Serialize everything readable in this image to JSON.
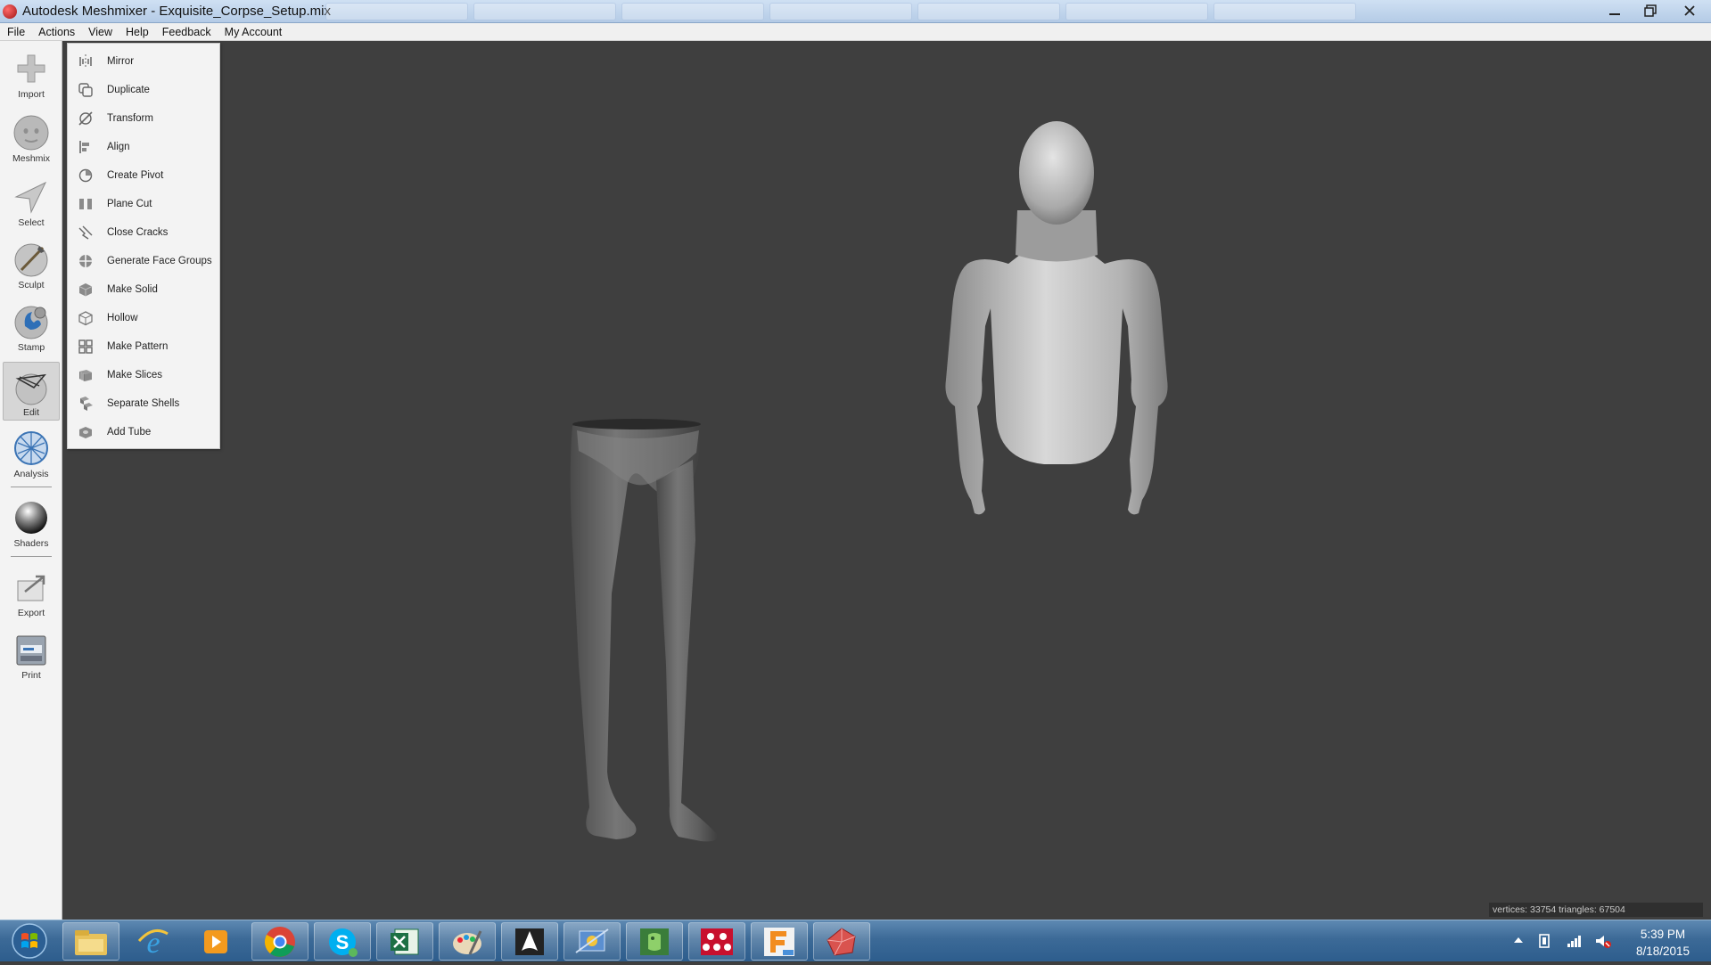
{
  "window": {
    "title": "Autodesk Meshmixer - Exquisite_Corpse_Setup.mix"
  },
  "menubar": [
    {
      "label": "File"
    },
    {
      "label": "Actions"
    },
    {
      "label": "View"
    },
    {
      "label": "Help"
    },
    {
      "label": "Feedback"
    },
    {
      "label": "My Account"
    }
  ],
  "toolbar": [
    {
      "label": "Import",
      "icon": "import-icon"
    },
    {
      "label": "Meshmix",
      "icon": "meshmix-icon"
    },
    {
      "label": "Select",
      "icon": "select-icon"
    },
    {
      "label": "Sculpt",
      "icon": "sculpt-icon"
    },
    {
      "label": "Stamp",
      "icon": "stamp-icon"
    },
    {
      "label": "Edit",
      "icon": "edit-icon",
      "active": true
    },
    {
      "label": "Analysis",
      "icon": "analysis-icon"
    },
    {
      "label": "Shaders",
      "icon": "shaders-icon"
    },
    {
      "label": "Export",
      "icon": "export-icon"
    },
    {
      "label": "Print",
      "icon": "print-icon"
    }
  ],
  "edit_menu": [
    {
      "label": "Mirror",
      "icon": "mirror-icon"
    },
    {
      "label": "Duplicate",
      "icon": "duplicate-icon"
    },
    {
      "label": "Transform",
      "icon": "transform-icon"
    },
    {
      "label": "Align",
      "icon": "align-icon"
    },
    {
      "label": "Create Pivot",
      "icon": "pivot-icon"
    },
    {
      "label": "Plane Cut",
      "icon": "plane-cut-icon"
    },
    {
      "label": "Close Cracks",
      "icon": "close-cracks-icon"
    },
    {
      "label": "Generate Face Groups",
      "icon": "face-groups-icon"
    },
    {
      "label": "Make Solid",
      "icon": "make-solid-icon"
    },
    {
      "label": "Hollow",
      "icon": "hollow-icon"
    },
    {
      "label": "Make Pattern",
      "icon": "make-pattern-icon"
    },
    {
      "label": "Make Slices",
      "icon": "make-slices-icon"
    },
    {
      "label": "Separate Shells",
      "icon": "separate-shells-icon"
    },
    {
      "label": "Add Tube",
      "icon": "add-tube-icon"
    }
  ],
  "status": {
    "text": "vertices: 33754 triangles: 67504"
  },
  "taskbar": {
    "apps": [
      {
        "icon": "file-explorer-icon"
      },
      {
        "icon": "internet-explorer-icon"
      },
      {
        "icon": "media-player-icon"
      },
      {
        "icon": "chrome-icon"
      },
      {
        "icon": "skype-icon"
      },
      {
        "icon": "excel-icon"
      },
      {
        "icon": "paint-icon"
      },
      {
        "icon": "inkscape-icon"
      },
      {
        "icon": "network-app-icon"
      },
      {
        "icon": "evernote-icon"
      },
      {
        "icon": "meshmixer-icon"
      },
      {
        "icon": "fusion-360-icon"
      },
      {
        "icon": "autodesk-app-icon"
      }
    ],
    "clock": {
      "time": "5:39 PM",
      "date": "8/18/2015"
    }
  },
  "colors": {
    "viewport_bg": "#3f3f3f",
    "panel_bg": "#f3f3f3",
    "taskbar": "#3c6a97"
  }
}
